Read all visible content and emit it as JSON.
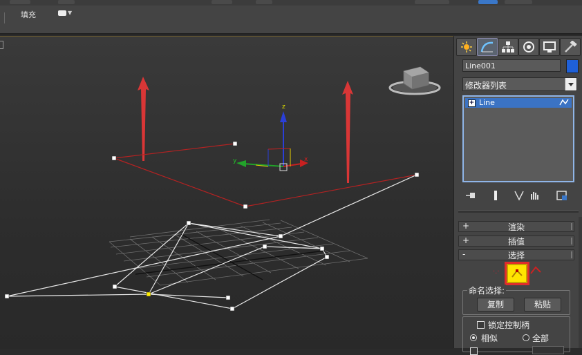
{
  "toolbar": {
    "fill_label": "填充"
  },
  "viewport": {
    "gizmo_labels": {
      "z": "z",
      "y": "y",
      "x": "x"
    }
  },
  "command_panel": {
    "tabs": [
      "create-icon",
      "modify-icon",
      "hierarchy-icon",
      "motion-icon",
      "display-icon",
      "utilities-icon"
    ],
    "active_tab": "modify-icon",
    "object_name": "Line001",
    "object_color": "#1f60d8",
    "modifier_list": "修改器列表",
    "stack_items": [
      {
        "label": "Line"
      }
    ],
    "rollouts": [
      {
        "sign": "+",
        "title": "渲染"
      },
      {
        "sign": "+",
        "title": "插值"
      },
      {
        "sign": "-",
        "title": "选择"
      }
    ],
    "selection": {
      "named_selection_label": "命名选择:",
      "copy_button": "复制",
      "paste_button": "粘贴",
      "lock_handles_label": "锁定控制柄",
      "similar_label": "相似",
      "all_label": "全部"
    }
  },
  "colors": {
    "highlight": "#e02c2c",
    "vertex_button": "#ffe400",
    "stack_selected": "#3b73c4"
  }
}
